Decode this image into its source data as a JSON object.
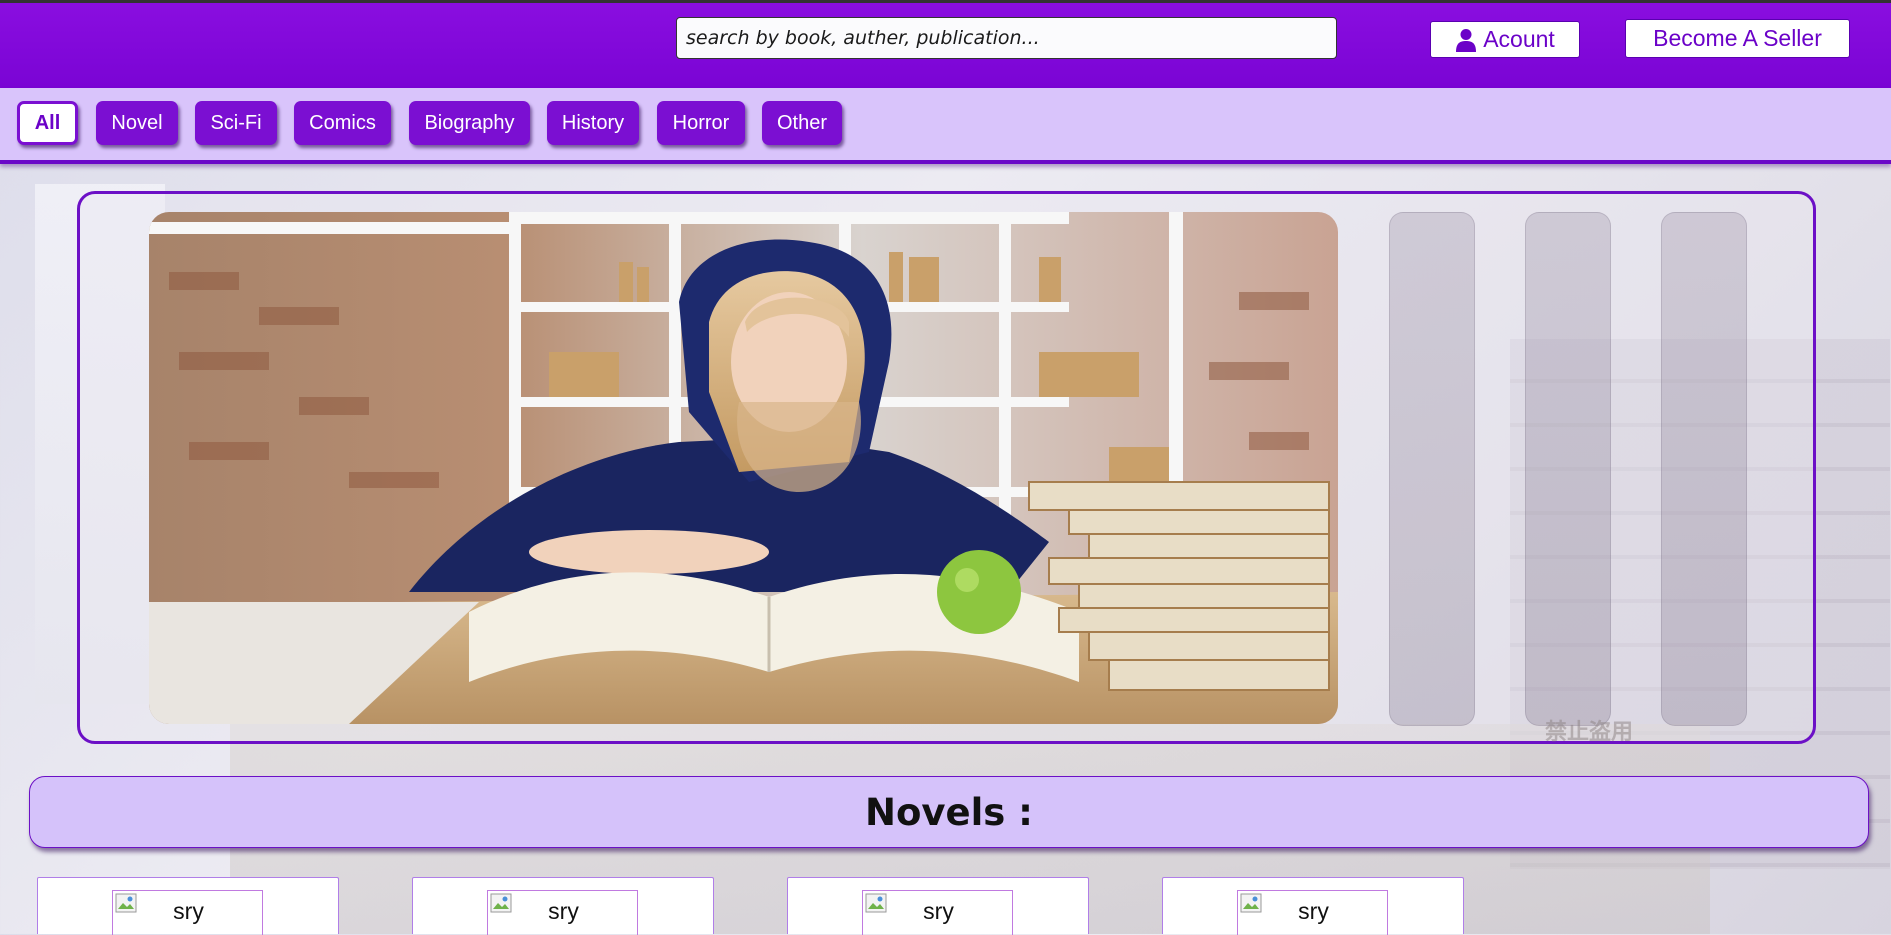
{
  "header": {
    "search_placeholder": "search by book, auther, publication...",
    "account_label": "Acount",
    "seller_label": "Become A Seller"
  },
  "categories": [
    "All",
    "Novel",
    "Sci-Fi",
    "Comics",
    "Biography",
    "History",
    "Horror",
    "Other"
  ],
  "active_category": "All",
  "carousel": {
    "slide_count": 4,
    "active_slide": 1,
    "watermark": "禁止盗用"
  },
  "section": {
    "title": "Novels  :"
  },
  "books": [
    {
      "alt": "sry"
    },
    {
      "alt": "sry"
    },
    {
      "alt": "sry"
    },
    {
      "alt": "sry"
    }
  ],
  "colors": {
    "brand": "#7b0fd2",
    "header_bg": "#8a0ee0",
    "category_bar": "#d9c4fb",
    "section_bg": "#d5c2fa"
  }
}
